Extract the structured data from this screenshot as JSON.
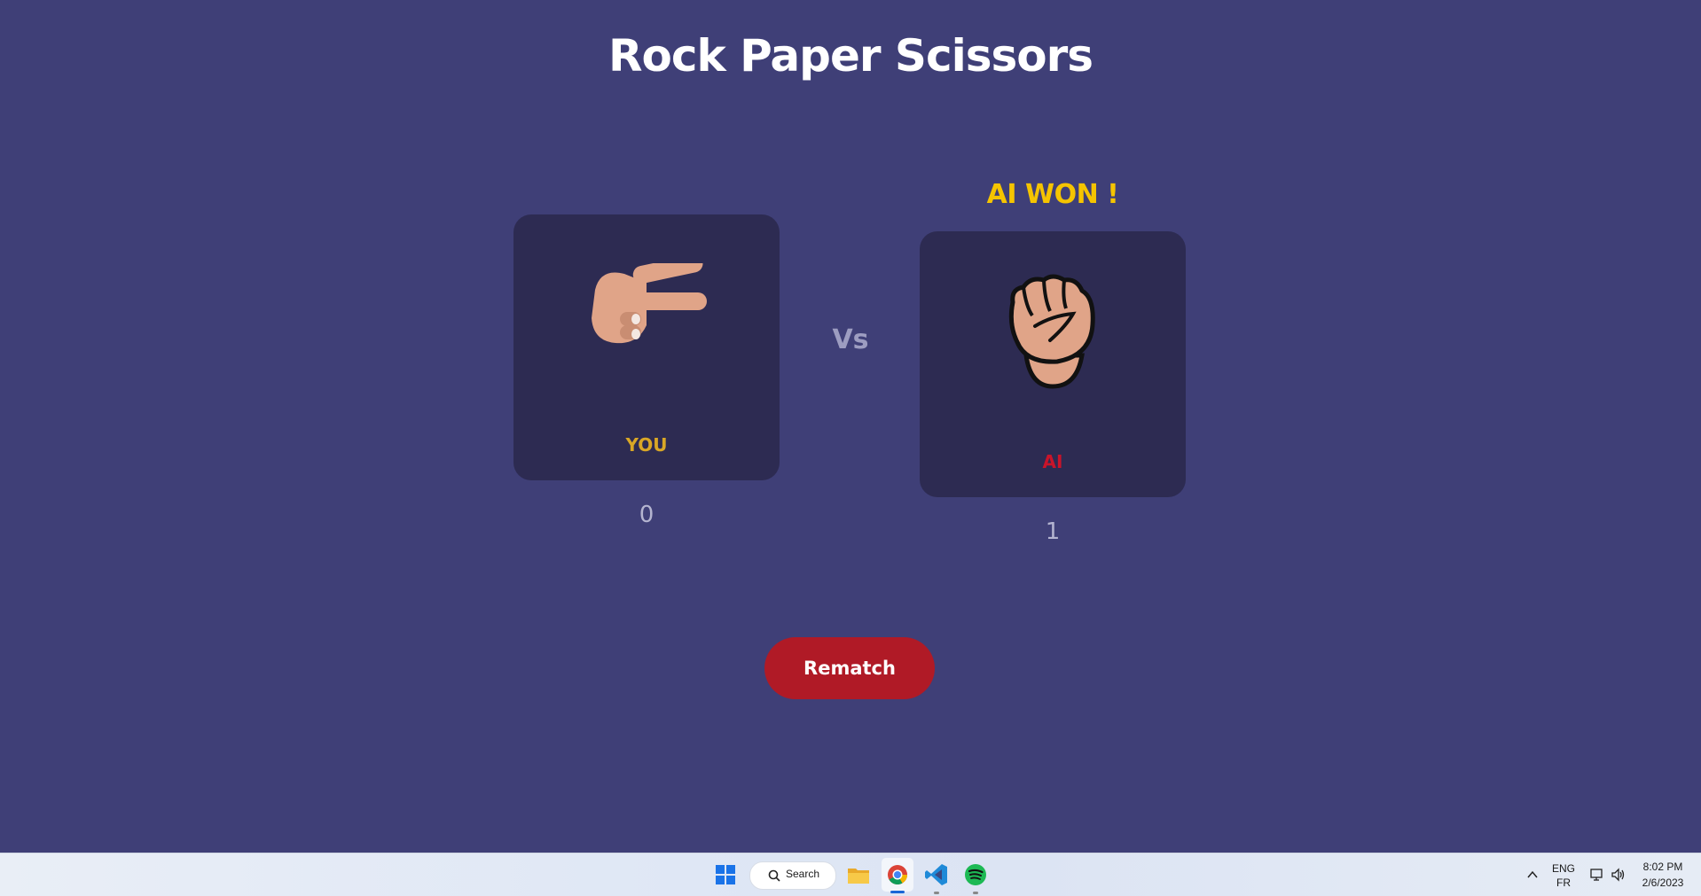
{
  "title": "Rock Paper Scissors",
  "result": "AI WON !",
  "vs": "Vs",
  "player": {
    "label": "YOU",
    "score": "0",
    "choice": "scissors",
    "label_color": "#d9a726"
  },
  "ai": {
    "label": "AI",
    "score": "1",
    "choice": "rock",
    "label_color": "#c9142a"
  },
  "rematch_label": "Rematch",
  "taskbar": {
    "search_label": "Search",
    "lang_top": "ENG",
    "lang_bottom": "FR",
    "time": "8:02 PM",
    "date": "2/6/2023",
    "apps": [
      "windows-start-icon",
      "file-explorer-icon",
      "chrome-icon",
      "vscode-icon",
      "spotify-icon"
    ]
  },
  "colors": {
    "background": "#3f3f77",
    "card": "#2d2b52",
    "result": "#f5c400",
    "button": "#b01a26"
  }
}
